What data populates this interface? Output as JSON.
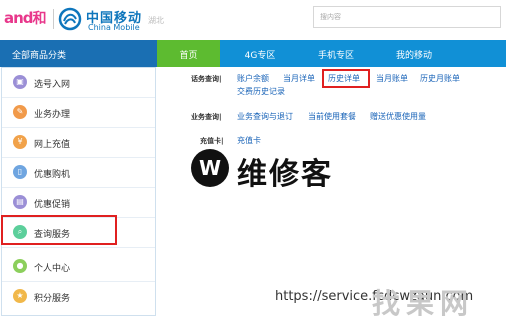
{
  "header": {
    "and_logo": "and",
    "and_logo_suffix": "和",
    "brand_cn": "中国移动",
    "brand_en": "China Mobile",
    "city": "湖北",
    "search_placeholder": "搜内容"
  },
  "nav": {
    "all_categories": "全部商品分类",
    "tabs": [
      {
        "label": "首页",
        "active": true
      },
      {
        "label": "4G专区",
        "active": false
      },
      {
        "label": "手机专区",
        "active": false
      },
      {
        "label": "我的移动",
        "active": false
      }
    ]
  },
  "sidebar": {
    "items": [
      {
        "label": "选号入网",
        "icon": "sim-card-icon",
        "color": "#9b8fd6"
      },
      {
        "label": "业务办理",
        "icon": "pencil-icon",
        "color": "#f19a4a"
      },
      {
        "label": "网上充值",
        "icon": "yen-icon",
        "color": "#f1a24a"
      },
      {
        "label": "优惠购机",
        "icon": "phone-icon",
        "color": "#6fa5e0"
      },
      {
        "label": "优惠促销",
        "icon": "gift-icon",
        "color": "#9b8fd6"
      },
      {
        "label": "查询服务",
        "icon": "magnifier-icon",
        "color": "#5ccf9b"
      },
      {
        "label": "个人中心",
        "icon": "person-icon",
        "color": "#8ccf5c"
      },
      {
        "label": "积分服务",
        "icon": "points-icon",
        "color": "#f1b84a"
      }
    ]
  },
  "main": {
    "rows": [
      {
        "label": "话务查询|",
        "links": [
          "账户余额",
          "当月详单",
          "历史详单",
          "当月账单",
          "历史月账单",
          "交费历史记录"
        ]
      },
      {
        "label": "业务查询|",
        "links": [
          "业务查询与退订",
          "当前使用套餐",
          "赠送优惠使用量"
        ]
      },
      {
        "label": "充值卡|",
        "links": [
          "充值卡"
        ]
      }
    ]
  },
  "watermark": {
    "logo_letter": "W",
    "text": "维修客",
    "url": "https://service.fcdcwzaun.com",
    "corner": "找果网"
  }
}
